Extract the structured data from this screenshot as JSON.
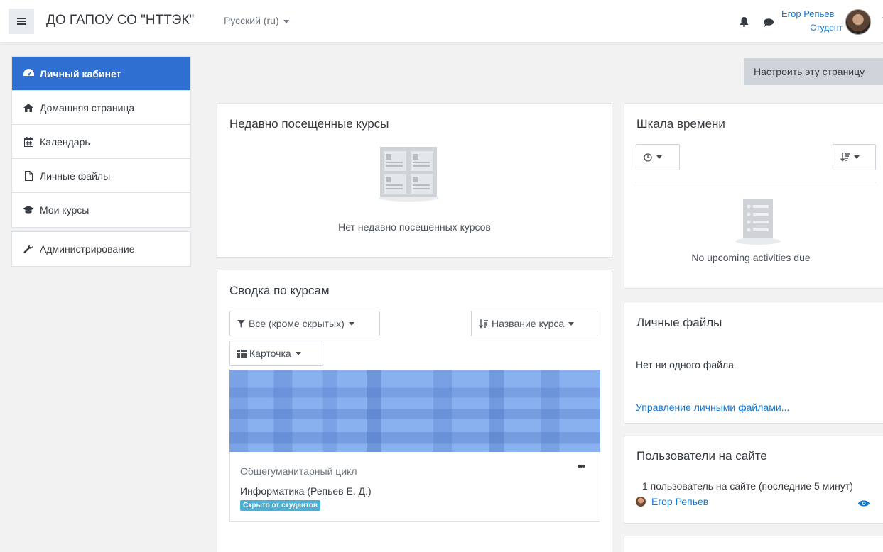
{
  "navbar": {
    "site_name": "ДО ГАПОУ СО \"НТТЭК\"",
    "language": "Русский (ru)",
    "user_name": "Егор Репьев",
    "user_role": "Студент"
  },
  "sidebar": {
    "items": [
      {
        "label": "Личный кабинет",
        "icon": "dashboard-icon",
        "active": true
      },
      {
        "label": "Домашняя страница",
        "icon": "home-icon"
      },
      {
        "label": "Календарь",
        "icon": "calendar-icon"
      },
      {
        "label": "Личные файлы",
        "icon": "file-icon"
      },
      {
        "label": "Мои курсы",
        "icon": "graduation-cap-icon"
      }
    ],
    "admin": {
      "label": "Администрирование",
      "icon": "wrench-icon"
    }
  },
  "main": {
    "customise_label": "Настроить эту страницу",
    "recent": {
      "title": "Недавно посещенные курсы",
      "empty": "Нет недавно посещенных курсов"
    },
    "overview": {
      "title": "Сводка по курсам",
      "filter_label": "Все (кроме скрытых)",
      "sort_label": "Название курса",
      "view_label": "Карточка",
      "course": {
        "category": "Общегуманитарный цикл",
        "name": "Информатика (Репьев Е. Д.)",
        "badge": "Скрыто от студентов",
        "menu": "•••"
      }
    }
  },
  "blocks": {
    "timeline": {
      "title": "Шкала времени",
      "empty": "No upcoming activities due"
    },
    "files": {
      "title": "Личные файлы",
      "empty": "Нет ни одного файла",
      "manage_link": "Управление личными файлами..."
    },
    "online": {
      "title": "Пользователи на сайте",
      "summary": "1 пользователь на сайте (последние 5 минут)",
      "user": "Егор Репьев"
    }
  },
  "colors": {
    "accent": "#2f6fd1",
    "link": "#1177d1",
    "badge": "#4bb0d3"
  }
}
